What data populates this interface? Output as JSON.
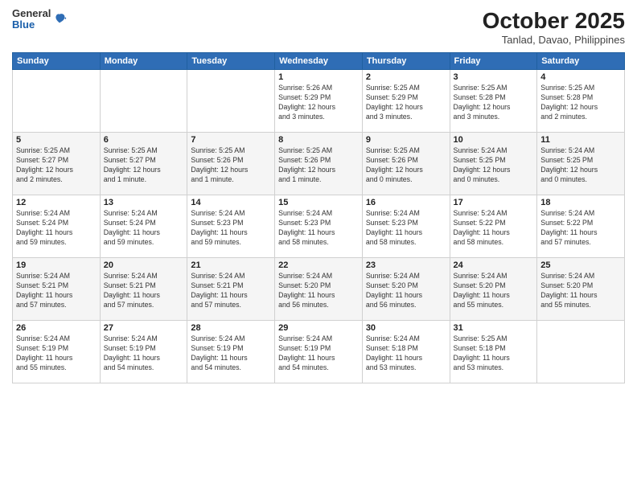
{
  "header": {
    "logo_general": "General",
    "logo_blue": "Blue",
    "month_title": "October 2025",
    "subtitle": "Tanlad, Davao, Philippines"
  },
  "days_of_week": [
    "Sunday",
    "Monday",
    "Tuesday",
    "Wednesday",
    "Thursday",
    "Friday",
    "Saturday"
  ],
  "weeks": [
    [
      {
        "day": "",
        "info": ""
      },
      {
        "day": "",
        "info": ""
      },
      {
        "day": "",
        "info": ""
      },
      {
        "day": "1",
        "info": "Sunrise: 5:26 AM\nSunset: 5:29 PM\nDaylight: 12 hours\nand 3 minutes."
      },
      {
        "day": "2",
        "info": "Sunrise: 5:25 AM\nSunset: 5:29 PM\nDaylight: 12 hours\nand 3 minutes."
      },
      {
        "day": "3",
        "info": "Sunrise: 5:25 AM\nSunset: 5:28 PM\nDaylight: 12 hours\nand 3 minutes."
      },
      {
        "day": "4",
        "info": "Sunrise: 5:25 AM\nSunset: 5:28 PM\nDaylight: 12 hours\nand 2 minutes."
      }
    ],
    [
      {
        "day": "5",
        "info": "Sunrise: 5:25 AM\nSunset: 5:27 PM\nDaylight: 12 hours\nand 2 minutes."
      },
      {
        "day": "6",
        "info": "Sunrise: 5:25 AM\nSunset: 5:27 PM\nDaylight: 12 hours\nand 1 minute."
      },
      {
        "day": "7",
        "info": "Sunrise: 5:25 AM\nSunset: 5:26 PM\nDaylight: 12 hours\nand 1 minute."
      },
      {
        "day": "8",
        "info": "Sunrise: 5:25 AM\nSunset: 5:26 PM\nDaylight: 12 hours\nand 1 minute."
      },
      {
        "day": "9",
        "info": "Sunrise: 5:25 AM\nSunset: 5:26 PM\nDaylight: 12 hours\nand 0 minutes."
      },
      {
        "day": "10",
        "info": "Sunrise: 5:24 AM\nSunset: 5:25 PM\nDaylight: 12 hours\nand 0 minutes."
      },
      {
        "day": "11",
        "info": "Sunrise: 5:24 AM\nSunset: 5:25 PM\nDaylight: 12 hours\nand 0 minutes."
      }
    ],
    [
      {
        "day": "12",
        "info": "Sunrise: 5:24 AM\nSunset: 5:24 PM\nDaylight: 11 hours\nand 59 minutes."
      },
      {
        "day": "13",
        "info": "Sunrise: 5:24 AM\nSunset: 5:24 PM\nDaylight: 11 hours\nand 59 minutes."
      },
      {
        "day": "14",
        "info": "Sunrise: 5:24 AM\nSunset: 5:23 PM\nDaylight: 11 hours\nand 59 minutes."
      },
      {
        "day": "15",
        "info": "Sunrise: 5:24 AM\nSunset: 5:23 PM\nDaylight: 11 hours\nand 58 minutes."
      },
      {
        "day": "16",
        "info": "Sunrise: 5:24 AM\nSunset: 5:23 PM\nDaylight: 11 hours\nand 58 minutes."
      },
      {
        "day": "17",
        "info": "Sunrise: 5:24 AM\nSunset: 5:22 PM\nDaylight: 11 hours\nand 58 minutes."
      },
      {
        "day": "18",
        "info": "Sunrise: 5:24 AM\nSunset: 5:22 PM\nDaylight: 11 hours\nand 57 minutes."
      }
    ],
    [
      {
        "day": "19",
        "info": "Sunrise: 5:24 AM\nSunset: 5:21 PM\nDaylight: 11 hours\nand 57 minutes."
      },
      {
        "day": "20",
        "info": "Sunrise: 5:24 AM\nSunset: 5:21 PM\nDaylight: 11 hours\nand 57 minutes."
      },
      {
        "day": "21",
        "info": "Sunrise: 5:24 AM\nSunset: 5:21 PM\nDaylight: 11 hours\nand 57 minutes."
      },
      {
        "day": "22",
        "info": "Sunrise: 5:24 AM\nSunset: 5:20 PM\nDaylight: 11 hours\nand 56 minutes."
      },
      {
        "day": "23",
        "info": "Sunrise: 5:24 AM\nSunset: 5:20 PM\nDaylight: 11 hours\nand 56 minutes."
      },
      {
        "day": "24",
        "info": "Sunrise: 5:24 AM\nSunset: 5:20 PM\nDaylight: 11 hours\nand 55 minutes."
      },
      {
        "day": "25",
        "info": "Sunrise: 5:24 AM\nSunset: 5:20 PM\nDaylight: 11 hours\nand 55 minutes."
      }
    ],
    [
      {
        "day": "26",
        "info": "Sunrise: 5:24 AM\nSunset: 5:19 PM\nDaylight: 11 hours\nand 55 minutes."
      },
      {
        "day": "27",
        "info": "Sunrise: 5:24 AM\nSunset: 5:19 PM\nDaylight: 11 hours\nand 54 minutes."
      },
      {
        "day": "28",
        "info": "Sunrise: 5:24 AM\nSunset: 5:19 PM\nDaylight: 11 hours\nand 54 minutes."
      },
      {
        "day": "29",
        "info": "Sunrise: 5:24 AM\nSunset: 5:19 PM\nDaylight: 11 hours\nand 54 minutes."
      },
      {
        "day": "30",
        "info": "Sunrise: 5:24 AM\nSunset: 5:18 PM\nDaylight: 11 hours\nand 53 minutes."
      },
      {
        "day": "31",
        "info": "Sunrise: 5:25 AM\nSunset: 5:18 PM\nDaylight: 11 hours\nand 53 minutes."
      },
      {
        "day": "",
        "info": ""
      }
    ]
  ]
}
